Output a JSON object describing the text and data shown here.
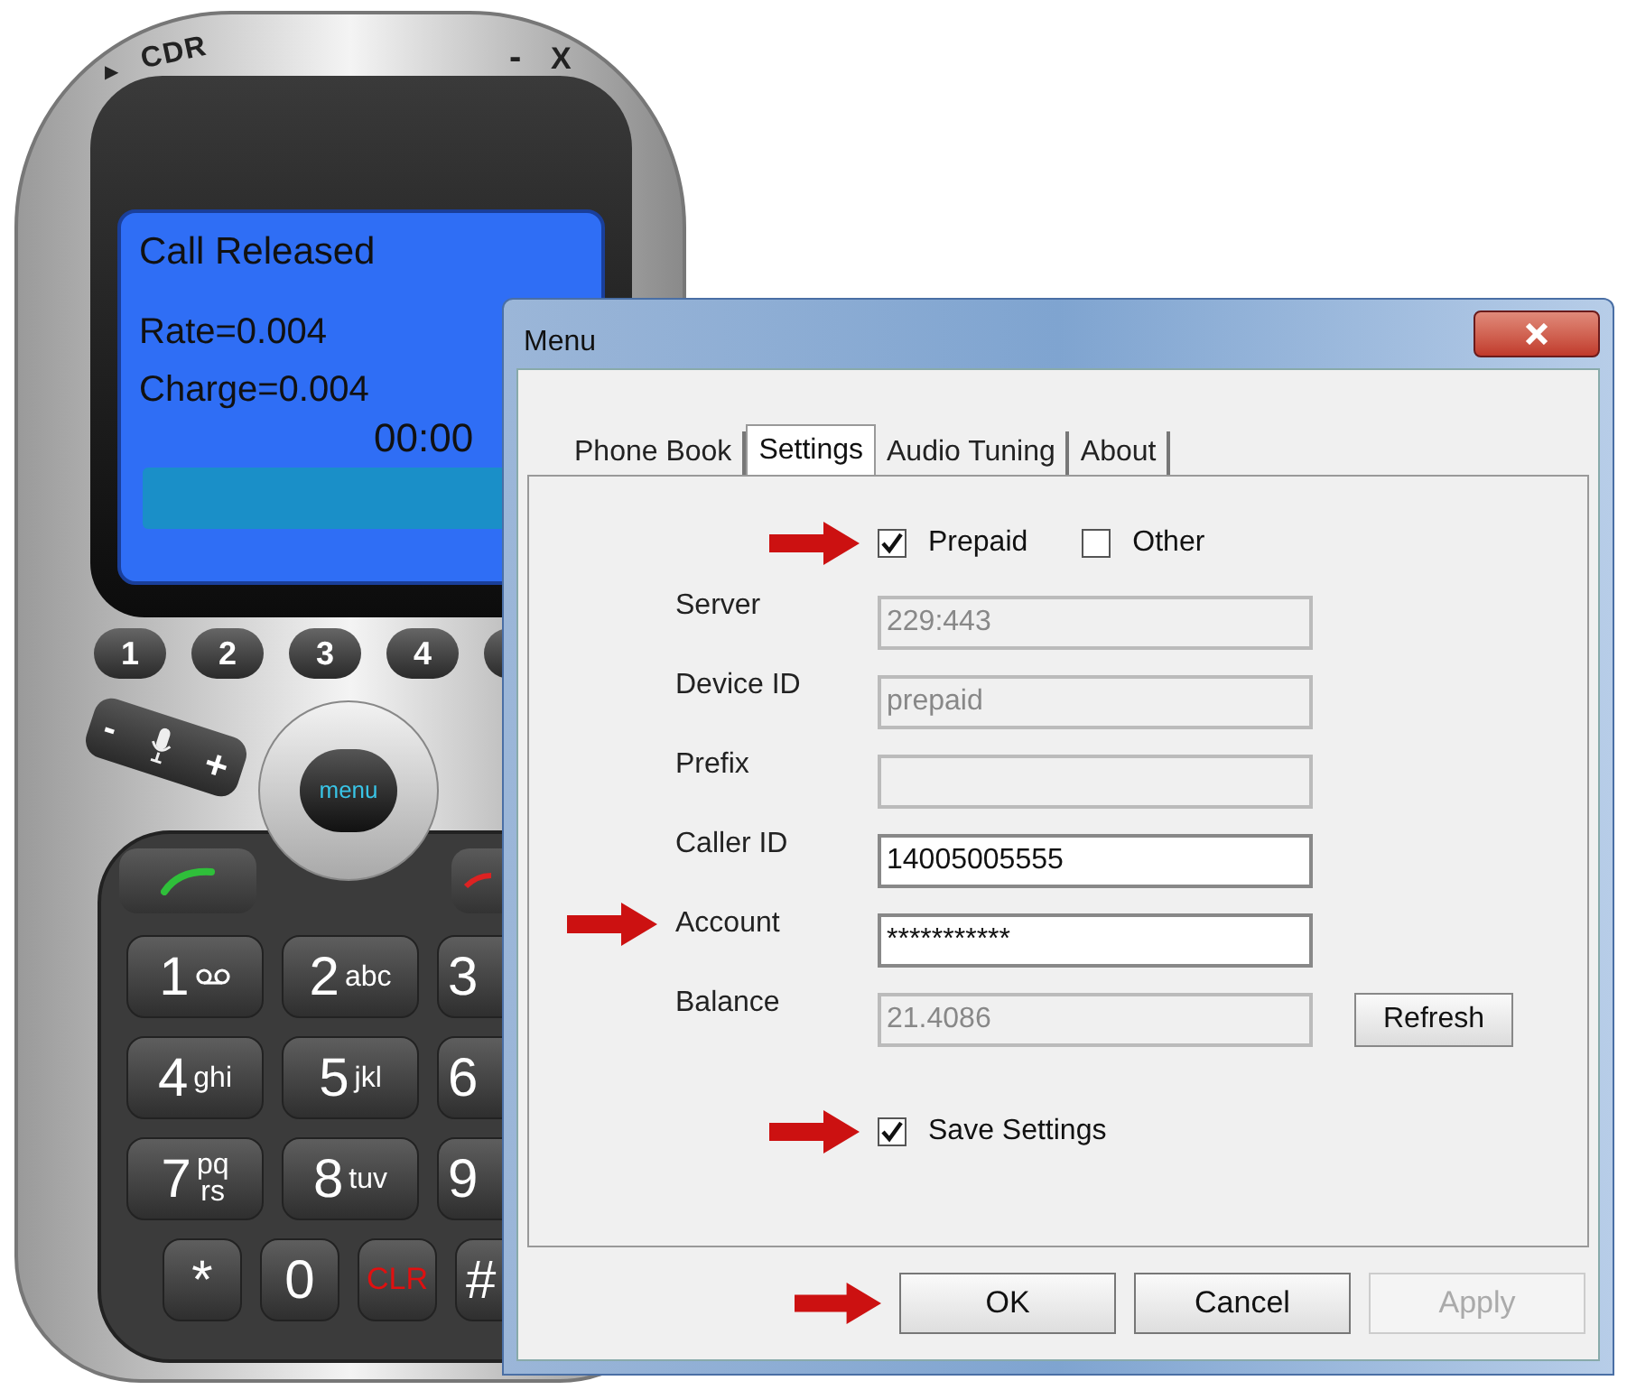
{
  "phone": {
    "brand_mark": "▶",
    "brand": "CDR",
    "window_buttons": [
      "-",
      "X"
    ],
    "display": {
      "status": "Call Released",
      "lines": [
        "Rate=0.004",
        "Charge=0.004"
      ],
      "timer": "00:00"
    },
    "soft_keys": [
      "1",
      "2",
      "3",
      "4"
    ],
    "volume": {
      "minus": "-",
      "plus": "+"
    },
    "nav": {
      "label": "menu"
    },
    "keypad": [
      [
        {
          "kind": "voicemail",
          "digit": "1"
        },
        {
          "kind": "digit",
          "digit": "2",
          "letters": [
            "abc"
          ]
        },
        {
          "kind": "digit",
          "digit": "3"
        }
      ],
      [
        {
          "kind": "digit",
          "digit": "4",
          "letters": [
            "ghi"
          ]
        },
        {
          "kind": "digit",
          "digit": "5",
          "letters": [
            "jkl"
          ]
        },
        {
          "kind": "digit",
          "digit": "6"
        }
      ],
      [
        {
          "kind": "digit",
          "digit": "7",
          "letters": [
            "pq",
            "rs"
          ]
        },
        {
          "kind": "digit",
          "digit": "8",
          "letters": [
            "tuv"
          ]
        },
        {
          "kind": "digit",
          "digit": "9"
        }
      ],
      [
        {
          "kind": "digit",
          "digit": "*"
        },
        {
          "kind": "digit",
          "digit": "0"
        },
        {
          "kind": "clear",
          "digit": "CLR"
        },
        {
          "kind": "digit",
          "digit": "#"
        }
      ]
    ]
  },
  "dialog": {
    "title": "Menu",
    "tabs": [
      {
        "label": "Phone Book",
        "selected": false
      },
      {
        "label": "Settings",
        "selected": true
      },
      {
        "label": "Audio Tuning",
        "selected": false
      },
      {
        "label": "About",
        "selected": false
      }
    ],
    "modes": [
      {
        "label": "Prepaid",
        "checked": true,
        "marked": true
      },
      {
        "label": "Other",
        "checked": false,
        "marked": false
      }
    ],
    "fields": [
      {
        "label": "Server",
        "value": "229:443",
        "disabled": true,
        "marked": false
      },
      {
        "label": "Device ID",
        "value": "prepaid",
        "disabled": true,
        "marked": false
      },
      {
        "label": "Prefix",
        "disabled": true,
        "marked": false
      },
      {
        "label": "Caller ID",
        "value": "14005005555",
        "disabled": false,
        "marked": false
      },
      {
        "label": "Account",
        "value": "***********",
        "disabled": false,
        "marked": true
      },
      {
        "label": "Balance",
        "value": "21.4086",
        "disabled": true,
        "marked": false,
        "button": "Refresh"
      }
    ],
    "save_settings": {
      "label": "Save Settings",
      "checked": true,
      "marked": true
    },
    "buttons": [
      {
        "label": "OK",
        "disabled": false,
        "marked": true
      },
      {
        "label": "Cancel",
        "disabled": false,
        "marked": false
      },
      {
        "label": "Apply",
        "disabled": true,
        "marked": false
      }
    ]
  }
}
